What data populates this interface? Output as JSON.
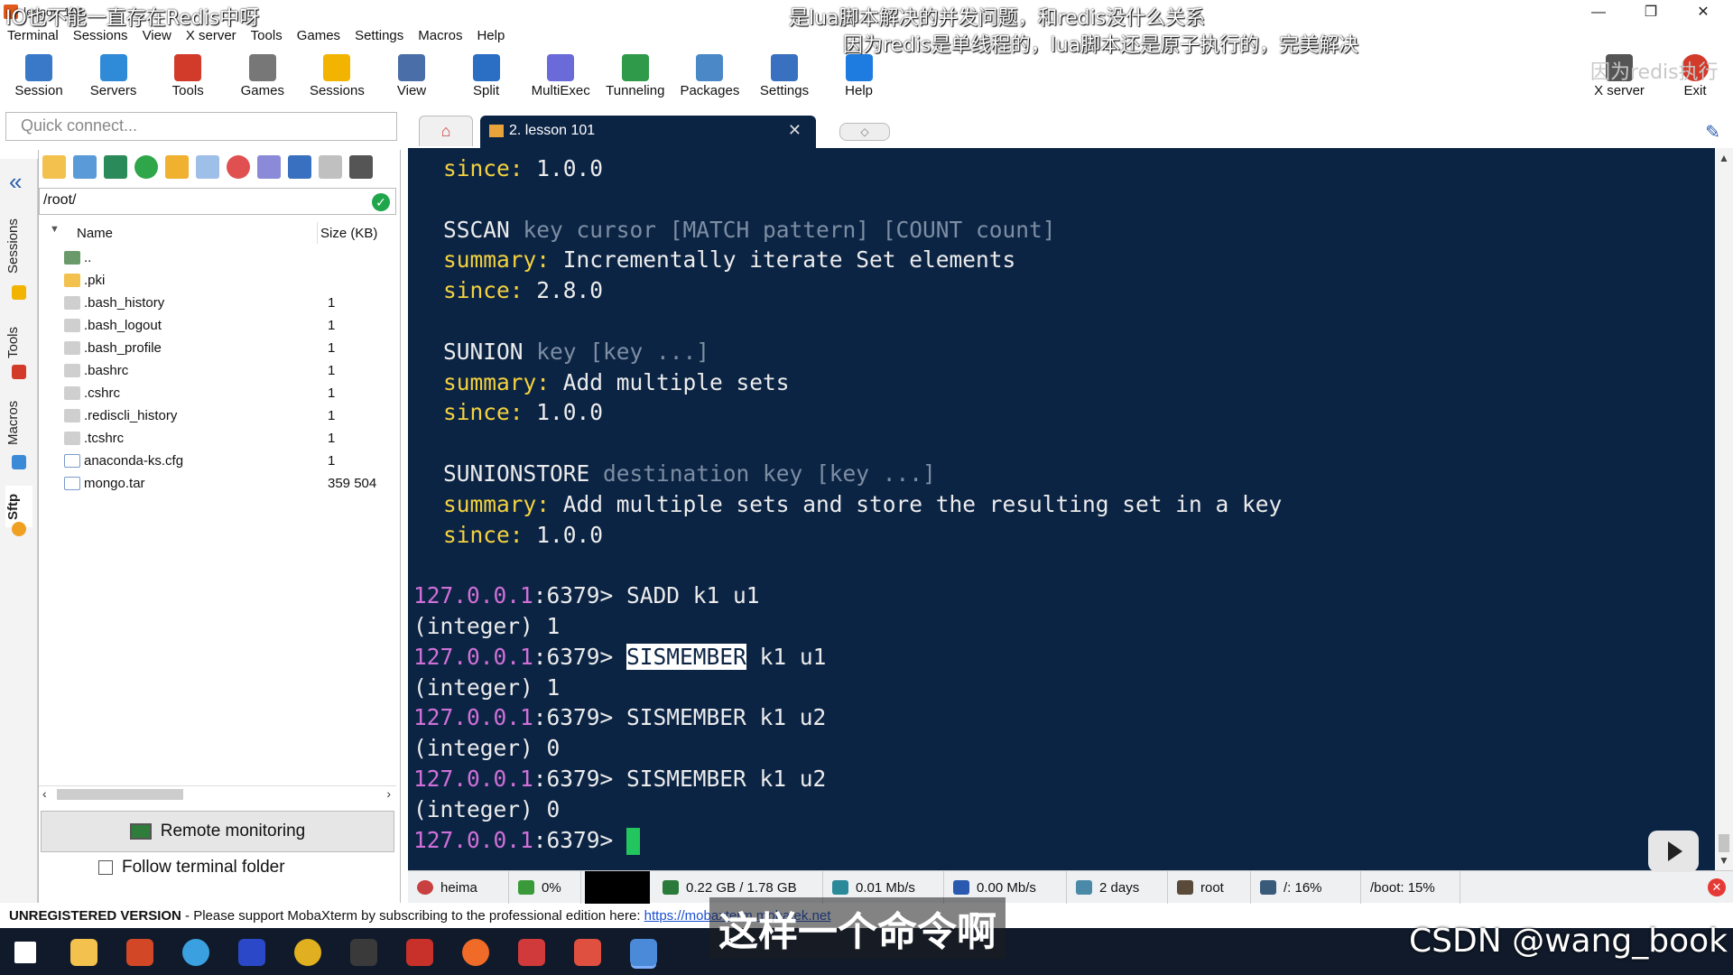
{
  "overlay": {
    "top_left": "IO也不能一直存在Redis中呀",
    "top_right_1": "是lua脚本解决的并发问题，和redis没什么关系",
    "top_right_2": "因为redis是单线程的，lua脚本还是原子执行的，完美解决",
    "top_right_3": "因为redis执行",
    "subtitle": "这样一个命令啊",
    "watermark": "CSDN @wang_book"
  },
  "window": {
    "title": "lesson 101"
  },
  "menu": [
    "Terminal",
    "Sessions",
    "View",
    "X server",
    "Tools",
    "Games",
    "Settings",
    "Macros",
    "Help"
  ],
  "toolbar": [
    {
      "label": "Session",
      "icon": "monitor-icon",
      "color": "#3a78c8"
    },
    {
      "label": "Servers",
      "icon": "servers-icon",
      "color": "#2f8ad8"
    },
    {
      "label": "Tools",
      "icon": "tools-icon",
      "color": "#d23a2a"
    },
    {
      "label": "Games",
      "icon": "games-icon",
      "color": "#777777"
    },
    {
      "label": "Sessions",
      "icon": "star-icon",
      "color": "#f2b400"
    },
    {
      "label": "View",
      "icon": "view-icon",
      "color": "#4a6ea8"
    },
    {
      "label": "Split",
      "icon": "split-icon",
      "color": "#2a6fc4"
    },
    {
      "label": "MultiExec",
      "icon": "fork-icon",
      "color": "#6a6ad8"
    },
    {
      "label": "Tunneling",
      "icon": "tunnel-icon",
      "color": "#2f9a4a"
    },
    {
      "label": "Packages",
      "icon": "package-icon",
      "color": "#4a88c8"
    },
    {
      "label": "Settings",
      "icon": "gear-icon",
      "color": "#3a70c0"
    },
    {
      "label": "Help",
      "icon": "help-icon",
      "color": "#1e7be0"
    }
  ],
  "toolbar_right": [
    {
      "label": "X server",
      "icon": "x-server-icon"
    },
    {
      "label": "Exit",
      "icon": "exit-icon"
    }
  ],
  "quick_connect": {
    "placeholder": "Quick connect..."
  },
  "side_tabs": [
    "Sessions",
    "Tools",
    "Macros",
    "Sftp"
  ],
  "sftp": {
    "path": "/root/",
    "columns": {
      "name": "Name",
      "size": "Size (KB)"
    },
    "files": [
      {
        "name": "..",
        "size": "",
        "kind": "parent"
      },
      {
        "name": ".pki",
        "size": "",
        "kind": "folder"
      },
      {
        "name": ".bash_history",
        "size": "1",
        "kind": "file"
      },
      {
        "name": ".bash_logout",
        "size": "1",
        "kind": "file"
      },
      {
        "name": ".bash_profile",
        "size": "1",
        "kind": "file"
      },
      {
        "name": ".bashrc",
        "size": "1",
        "kind": "file"
      },
      {
        "name": ".cshrc",
        "size": "1",
        "kind": "file"
      },
      {
        "name": ".rediscli_history",
        "size": "1",
        "kind": "file"
      },
      {
        "name": ".tcshrc",
        "size": "1",
        "kind": "file"
      },
      {
        "name": "anaconda-ks.cfg",
        "size": "1",
        "kind": "cfg"
      },
      {
        "name": "mongo.tar",
        "size": "359 504",
        "kind": "archive"
      }
    ],
    "remote_monitoring": "Remote monitoring",
    "follow_folder": "Follow terminal folder"
  },
  "tabs": {
    "active": "2. lesson 101"
  },
  "terminal": {
    "lines": [
      {
        "type": "kv",
        "key": "since:",
        "value": "1.0.0"
      },
      {
        "type": "blank"
      },
      {
        "type": "cmd",
        "name": "SSCAN",
        "args": "key cursor [MATCH pattern] [COUNT count]"
      },
      {
        "type": "kv",
        "key": "summary:",
        "value": "Incrementally iterate Set elements"
      },
      {
        "type": "kv",
        "key": "since:",
        "value": "2.8.0"
      },
      {
        "type": "blank"
      },
      {
        "type": "cmd",
        "name": "SUNION",
        "args": "key [key ...]"
      },
      {
        "type": "kv",
        "key": "summary:",
        "value": "Add multiple sets"
      },
      {
        "type": "kv",
        "key": "since:",
        "value": "1.0.0"
      },
      {
        "type": "blank"
      },
      {
        "type": "cmd",
        "name": "SUNIONSTORE",
        "args": "destination key [key ...]"
      },
      {
        "type": "kv",
        "key": "summary:",
        "value": "Add multiple sets and store the resulting set in a key"
      },
      {
        "type": "kv",
        "key": "since:",
        "value": "1.0.0"
      },
      {
        "type": "blank"
      },
      {
        "type": "prompt",
        "host": "127.0.0.1",
        "port": ":6379>",
        "cmd": "SADD k1 u1",
        "sel": ""
      },
      {
        "type": "out",
        "text": "(integer) 1"
      },
      {
        "type": "prompt",
        "host": "127.0.0.1",
        "port": ":6379>",
        "cmd": " k1 u1",
        "sel": "SISMEMBER"
      },
      {
        "type": "out",
        "text": "(integer) 1"
      },
      {
        "type": "prompt",
        "host": "127.0.0.1",
        "port": ":6379>",
        "cmd": "SISMEMBER k1 u2",
        "sel": ""
      },
      {
        "type": "out",
        "text": "(integer) 0"
      },
      {
        "type": "prompt",
        "host": "127.0.0.1",
        "port": ":6379>",
        "cmd": "SISMEMBER k1 u2",
        "sel": ""
      },
      {
        "type": "out",
        "text": "(integer) 0"
      },
      {
        "type": "prompt",
        "host": "127.0.0.1",
        "port": ":6379>",
        "cmd": "",
        "sel": "",
        "cursor": true
      }
    ]
  },
  "status": {
    "host": "heima",
    "cpu": "0%",
    "memory": "0.22 GB / 1.78 GB",
    "upload": "0.01 Mb/s",
    "download": "0.00 Mb/s",
    "uptime": "2 days",
    "user": "root",
    "disk_root": "/: 16%",
    "disk_boot": "/boot: 15%"
  },
  "unregistered": {
    "label": "UNREGISTERED VERSION",
    "message": "  -  Please support MobaXterm by subscribing to the professional edition here: ",
    "link": "https://mobaxterm.mobatek.net"
  },
  "taskbar": [
    {
      "icon": "windows-start-icon",
      "color": "#ffffff"
    },
    {
      "icon": "file-explorer-icon",
      "color": "#f2c14e"
    },
    {
      "icon": "powerpoint-icon",
      "color": "#d24726"
    },
    {
      "icon": "color-app-icon",
      "color": "#3aa0e0"
    },
    {
      "icon": "intellij-icon",
      "color": "#2a48c8"
    },
    {
      "icon": "chrome-icon",
      "color": "#e0b020"
    },
    {
      "icon": "terminal-icon",
      "color": "#3a3a3a"
    },
    {
      "icon": "redis-icon",
      "color": "#c8302a"
    },
    {
      "icon": "postman-icon",
      "color": "#f06a28"
    },
    {
      "icon": "pen-icon",
      "color": "#d03a3a"
    },
    {
      "icon": "notes-icon",
      "color": "#e05040"
    },
    {
      "icon": "mobaxterm-icon",
      "color": "#4a8ad8"
    }
  ]
}
